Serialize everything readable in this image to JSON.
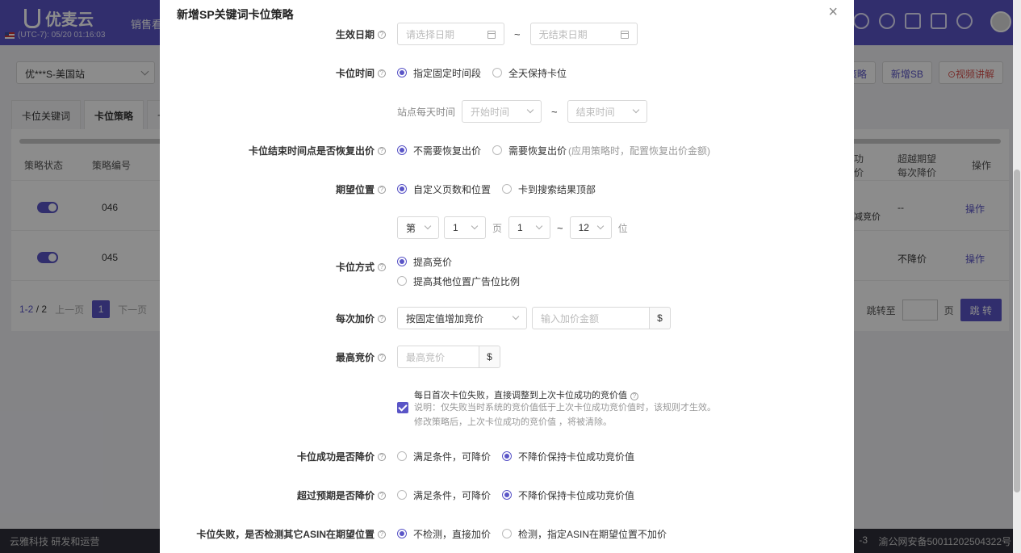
{
  "app": {
    "logo_text": "优麦云",
    "timezone": "(UTC-7): 05/20 01:16:03",
    "nav_item": "销售看",
    "store": "优***S-美国站",
    "buttons": {
      "policy": "位策略",
      "new_sb": "新增SB",
      "video": "⊙视频讲解"
    },
    "tabs": [
      "卡位关键词",
      "卡位策略",
      "卡"
    ],
    "table": {
      "headers": {
        "status": "策略状态",
        "code": "策略编号",
        "col_a": "功\n价",
        "col_b": "超越期望\n每次降价",
        "ops": "操作"
      },
      "rows": [
        {
          "code": "046",
          "col_a": "减竞价",
          "col_b": "--",
          "op": "操作"
        },
        {
          "code": "045",
          "col_a": "",
          "col_b": "不降价",
          "op": "操作"
        }
      ]
    },
    "pager": {
      "range": "1-2",
      "sep": "/",
      "total": "2",
      "prev": "上一页",
      "page": "1",
      "next": "下一页",
      "jump_label": "跳转至",
      "page_unit": "页",
      "jump_btn": "跳 转"
    },
    "footer": {
      "left": "云雅科技 研发和运营",
      "mid": "-3",
      "right": "渝公网安备50011202504322号"
    }
  },
  "modal": {
    "title": "新增SP关键词卡位策略",
    "close": "×",
    "effective_date": {
      "label": "生效日期",
      "start_placeholder": "请选择日期",
      "end_placeholder": "无结束日期",
      "sep": "~"
    },
    "slot_time": {
      "label": "卡位时间",
      "opt1": "指定固定时间段",
      "opt2": "全天保持卡位"
    },
    "site_time": {
      "label": "站点每天时间",
      "start_placeholder": "开始时间",
      "end_placeholder": "结束时间",
      "sep": "~"
    },
    "restore": {
      "label": "卡位结束时间点是否恢复出价",
      "opt1": "不需要恢复出价",
      "opt2": "需要恢复出价",
      "note": "(应用策略时，配置恢复出价金额)"
    },
    "expected_pos": {
      "label": "期望位置",
      "opt1": "自定义页数和位置",
      "opt2": "卡到搜索结果顶部"
    },
    "page_pos": {
      "prefix": "第",
      "page_val": "1",
      "page_unit": "页",
      "from": "1",
      "sep": "~",
      "to": "12",
      "pos_unit": "位"
    },
    "method": {
      "label": "卡位方式",
      "opt1": "提高竞价",
      "opt2": "提高其他位置广告位比例"
    },
    "increment": {
      "label": "每次加价",
      "mode": "按固定值增加竞价",
      "amount_placeholder": "输入加价金额",
      "currency": "$"
    },
    "max_bid": {
      "label": "最高竞价",
      "placeholder": "最高竞价",
      "currency": "$"
    },
    "first_fail": {
      "text": "每日首次卡位失败，直接调整到上次卡位成功的竞价值",
      "note1": "说明：仅失败当时系统的竞价值低于上次卡位成功竞价值时，该规则才生效。",
      "note2": "修改策略后，上次卡位成功的竞价值 ，将被清除。"
    },
    "success_lower": {
      "label": "卡位成功是否降价",
      "opt1": "满足条件，可降价",
      "opt2": "不降价保持卡位成功竞价值"
    },
    "exceed_lower": {
      "label": "超过预期是否降价",
      "opt1": "满足条件，可降价",
      "opt2": "不降价保持卡位成功竞价值"
    },
    "fail_check": {
      "label": "卡位失败，是否检测其它ASIN在期望位置",
      "opt1": "不检测，直接加价",
      "opt2": "检测，指定ASIN在期望位置不加价"
    }
  }
}
